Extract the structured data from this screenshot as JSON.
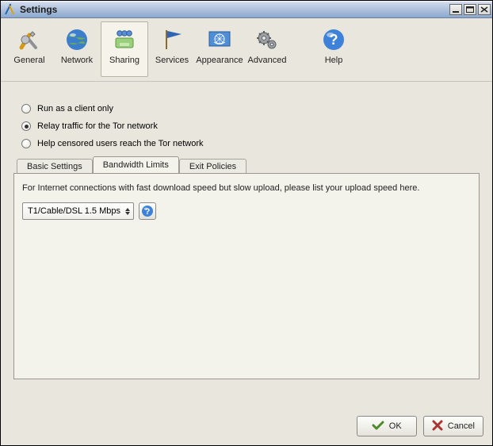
{
  "window": {
    "title": "Settings"
  },
  "toolbar": {
    "items": [
      {
        "label": "General"
      },
      {
        "label": "Network"
      },
      {
        "label": "Sharing"
      },
      {
        "label": "Services"
      },
      {
        "label": "Appearance"
      },
      {
        "label": "Advanced"
      }
    ],
    "help_label": "Help",
    "selected_index": 2
  },
  "relay_mode": {
    "options": [
      {
        "label": "Run as a client only",
        "selected": false
      },
      {
        "label": "Relay traffic for the Tor network",
        "selected": true
      },
      {
        "label": "Help censored users reach the Tor network",
        "selected": false
      }
    ]
  },
  "tabs": {
    "items": [
      {
        "label": "Basic Settings"
      },
      {
        "label": "Bandwidth Limits"
      },
      {
        "label": "Exit Policies"
      }
    ],
    "active_index": 1
  },
  "bandwidth_panel": {
    "description": "For Internet connections with fast download speed but slow upload, please list your upload speed here.",
    "selected_speed": "T1/Cable/DSL 1.5 Mbps"
  },
  "buttons": {
    "ok": "OK",
    "cancel": "Cancel"
  }
}
